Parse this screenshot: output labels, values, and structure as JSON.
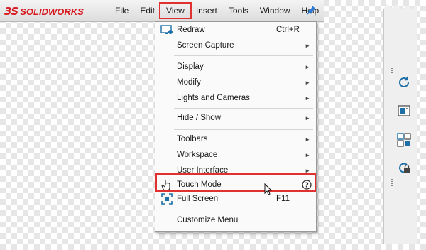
{
  "app": {
    "logo_mark": "3S",
    "logo_text": "SOLIDWORKS"
  },
  "menubar": [
    "File",
    "Edit",
    "View",
    "Insert",
    "Tools",
    "Window",
    "Help"
  ],
  "active_menu": "View",
  "view_menu": {
    "redraw": {
      "label": "Redraw",
      "shortcut": "Ctrl+R"
    },
    "screen_capture": "Screen Capture",
    "display": "Display",
    "modify": "Modify",
    "lights_cameras": "Lights and Cameras",
    "hide_show": "Hide / Show",
    "toolbars": "Toolbars",
    "workspace": "Workspace",
    "user_interface": "User Interface",
    "touch_mode": "Touch Mode",
    "full_screen": {
      "label": "Full Screen",
      "shortcut": "F11"
    },
    "customize": "Customize Menu"
  },
  "submenu_arrow": "►",
  "colors": {
    "brand": "#d71920",
    "highlight": "#e03030",
    "accent_blue": "#1d6fa5"
  },
  "right_panel_icons": [
    "rotate-view-icon",
    "display-pane-icon",
    "view-palette-icon",
    "lock-rotate-icon"
  ]
}
